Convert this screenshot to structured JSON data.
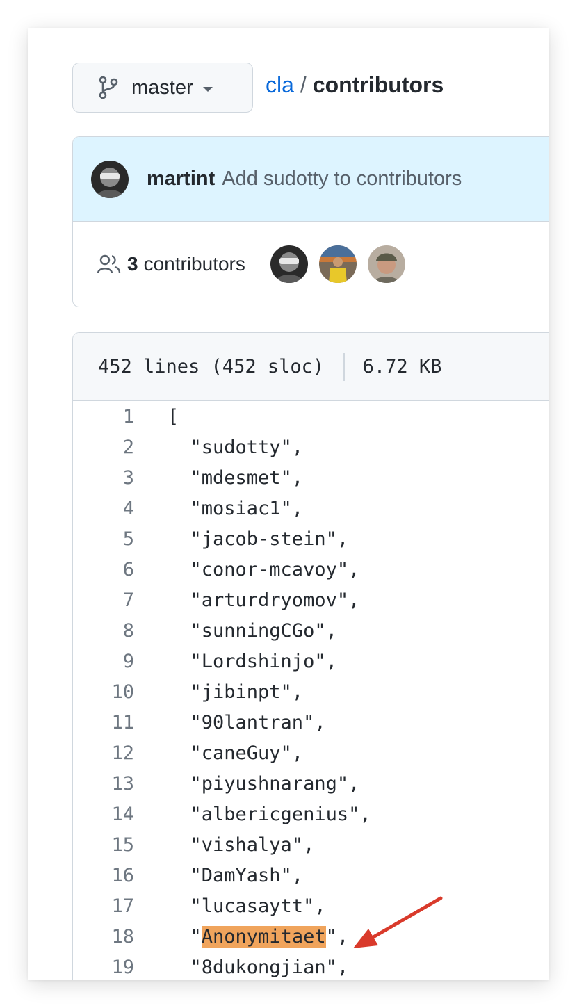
{
  "header": {
    "branch_label": "master",
    "breadcrumb_repo": "cla",
    "breadcrumb_separator": "/",
    "breadcrumb_file": "contributors"
  },
  "commit": {
    "author": "martint",
    "message": "Add sudotty to contributors"
  },
  "contributors": {
    "count": "3",
    "label": "contributors",
    "avatars": [
      "avatar-martint",
      "avatar-contributor-2",
      "avatar-contributor-3"
    ]
  },
  "file": {
    "lines_info": "452 lines (452 sloc)",
    "size": "6.72 KB"
  },
  "code_lines": [
    {
      "num": "1",
      "text": "["
    },
    {
      "num": "2",
      "text": "  \"sudotty\","
    },
    {
      "num": "3",
      "text": "  \"mdesmet\","
    },
    {
      "num": "4",
      "text": "  \"mosiac1\","
    },
    {
      "num": "5",
      "text": "  \"jacob-stein\","
    },
    {
      "num": "6",
      "text": "  \"conor-mcavoy\","
    },
    {
      "num": "7",
      "text": "  \"arturdryomov\","
    },
    {
      "num": "8",
      "text": "  \"sunningCGo\","
    },
    {
      "num": "9",
      "text": "  \"Lordshinjo\","
    },
    {
      "num": "10",
      "text": "  \"jibinpt\","
    },
    {
      "num": "11",
      "text": "  \"90lantran\","
    },
    {
      "num": "12",
      "text": "  \"caneGuy\","
    },
    {
      "num": "13",
      "text": "  \"piyushnarang\","
    },
    {
      "num": "14",
      "text": "  \"albericgenius\","
    },
    {
      "num": "15",
      "text": "  \"vishalya\","
    },
    {
      "num": "16",
      "text": "  \"DamYash\","
    },
    {
      "num": "17",
      "text": "  \"lucasaytt\","
    },
    {
      "num": "18",
      "text_before": "  \"",
      "highlight": "Anonymitaet",
      "text_after": "\","
    },
    {
      "num": "19",
      "text": "  \"8dukongjian\","
    }
  ],
  "colors": {
    "highlight": "#f0a45c",
    "arrow": "#d93a2b",
    "link": "#0969da",
    "commit_bg": "#ddf4ff"
  }
}
